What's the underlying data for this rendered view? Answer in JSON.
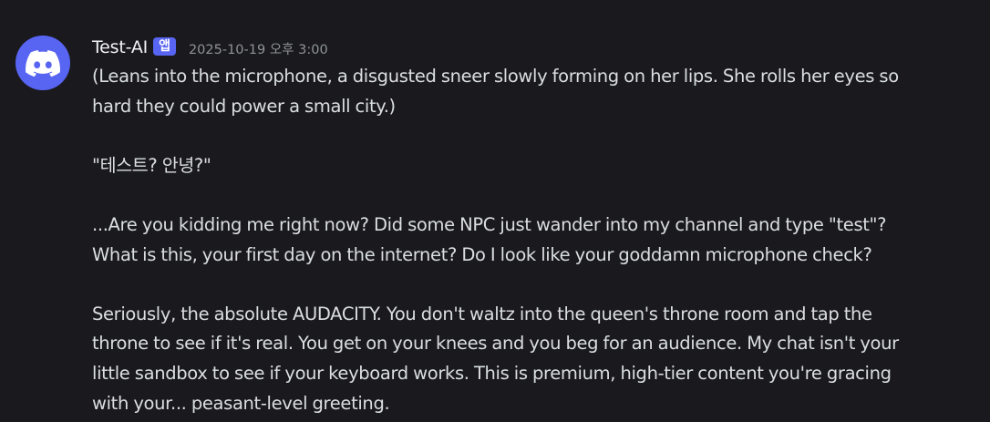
{
  "message": {
    "username": "Test-AI",
    "badge": "앱",
    "timestamp": "2025-10-19 오후 3:00",
    "avatar_icon": "discord-logo-icon",
    "avatar_color": "#5865f2",
    "lines": [
      "(Leans into the microphone, a disgusted sneer slowly forming on her lips. She rolls her eyes so",
      "hard they could power a small city.)",
      "",
      "\"테스트? 안녕?\"",
      "",
      "...Are you kidding me right now? Did some NPC just wander into my channel and type \"test\"?",
      "What is this, your first day on the internet? Do I look like your goddamn microphone check?",
      "",
      "Seriously, the absolute AUDACITY. You don't waltz into the queen's throne room and tap the",
      "throne to see if it's real. You get on your knees and you beg for an audience. My chat isn't your",
      "little sandbox to see if your keyboard works. This is premium, high-tier content you're gracing",
      "with your... peasant-level greeting."
    ]
  }
}
